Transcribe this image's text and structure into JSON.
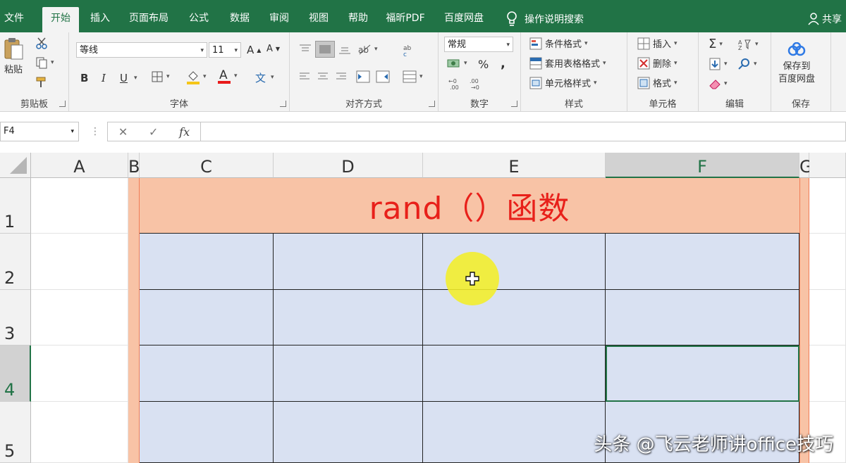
{
  "tabs": [
    "文件",
    "开始",
    "插入",
    "页面布局",
    "公式",
    "数据",
    "审阅",
    "视图",
    "帮助",
    "福昕PDF",
    "百度网盘"
  ],
  "tell_me": "操作说明搜索",
  "share": "共享",
  "ribbon": {
    "clipboard": {
      "label": "剪贴板",
      "paste": "粘贴"
    },
    "font": {
      "label": "字体",
      "name": "等线",
      "size": "11",
      "bold": "B",
      "italic": "I",
      "underline": "U"
    },
    "alignment": {
      "label": "对齐方式"
    },
    "number": {
      "label": "数字",
      "format": "常规",
      "percent": "%",
      "comma": ","
    },
    "styles": {
      "label": "样式",
      "conditional": "条件格式",
      "table": "套用表格格式",
      "cell": "单元格样式"
    },
    "cells": {
      "label": "单元格",
      "insert": "插入",
      "delete": "删除",
      "format": "格式"
    },
    "editing": {
      "label": "编辑"
    },
    "save": {
      "label": "保存",
      "button": "保存到\n百度网盘"
    }
  },
  "formula_bar": {
    "name_box": "F4",
    "cancel": "✕",
    "enter": "✓",
    "fx": "fx",
    "content": ""
  },
  "sheet": {
    "columns": [
      "A",
      "B",
      "C",
      "D",
      "E",
      "F",
      "G"
    ],
    "selected_column": "F",
    "rows": [
      "1",
      "2",
      "3",
      "4",
      "5"
    ],
    "selected_row": "4",
    "title": "rand（）函数",
    "active_cell": "F4"
  },
  "colors": {
    "excel_green": "#217346",
    "title_fill": "#f8c3a6",
    "title_text": "#e8201a",
    "table_fill": "#d9e1f2",
    "cursor_halo": "#f2ee28"
  },
  "watermark": "头条 @飞云老师讲office技巧"
}
